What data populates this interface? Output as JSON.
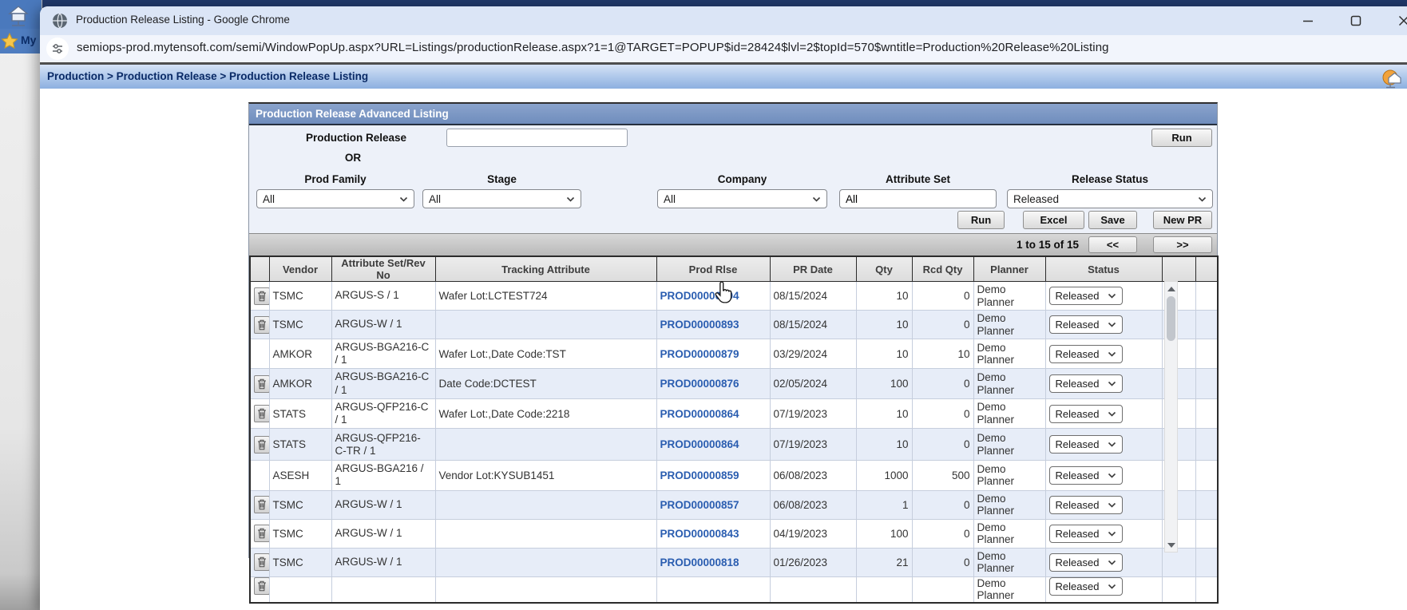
{
  "browser": {
    "window_title": "Production Release Listing - Google Chrome",
    "url": "semiops-prod.mytensoft.com/semi/WindowPopUp.aspx?URL=Listings/productionRelease.aspx?1=1@TARGET=POPUP$id=28424$lvl=2$topId=570$wntitle=Production%20Release%20Listing"
  },
  "parent_window": {
    "favorites_label": "My"
  },
  "breadcrumb": {
    "text": "Production > Production Release > Production Release Listing"
  },
  "panel": {
    "title": "Production Release Advanced Listing",
    "form": {
      "production_release": {
        "label": "Production Release",
        "value": ""
      },
      "or_label": "OR",
      "top_run_label": "Run",
      "filters": [
        {
          "label": "Prod Family",
          "type": "select",
          "value": "All"
        },
        {
          "label": "Stage",
          "type": "select",
          "value": "All"
        },
        {
          "label": "Company",
          "type": "select",
          "value": "All"
        },
        {
          "label": "Attribute Set",
          "type": "input",
          "value": "All"
        },
        {
          "label": "Release Status",
          "type": "select",
          "value": "Released"
        }
      ],
      "action_buttons": [
        "Run",
        "Excel",
        "Save",
        "New PR"
      ]
    },
    "pagination": {
      "range_text": "1 to 15 of 15",
      "prev_label": "<<",
      "next_label": ">>"
    }
  },
  "table": {
    "headers": [
      "",
      "Vendor",
      "Attribute Set/Rev No",
      "Tracking Attribute",
      "Prod Rlse",
      "PR Date",
      "Qty",
      "Rcd Qty",
      "Planner",
      "Status",
      "",
      ""
    ],
    "rows": [
      {
        "can_delete": true,
        "vendor": "TSMC",
        "attr_set": "ARGUS-S / 1",
        "tracking": "Wafer Lot:LCTEST724",
        "prod_rlse": "PROD00000894",
        "pr_date": "08/15/2024",
        "qty": "10",
        "rcd_qty": "0",
        "planner": "Demo Planner",
        "status": "Released"
      },
      {
        "can_delete": true,
        "vendor": "TSMC",
        "attr_set": "ARGUS-W / 1",
        "tracking": "",
        "prod_rlse": "PROD00000893",
        "pr_date": "08/15/2024",
        "qty": "10",
        "rcd_qty": "0",
        "planner": "Demo Planner",
        "status": "Released"
      },
      {
        "can_delete": false,
        "vendor": "AMKOR",
        "attr_set": "ARGUS-BGA216-C / 1",
        "tracking": "Wafer Lot:,Date Code:TST",
        "prod_rlse": "PROD00000879",
        "pr_date": "03/29/2024",
        "qty": "10",
        "rcd_qty": "10",
        "planner": "Demo Planner",
        "status": "Released"
      },
      {
        "can_delete": true,
        "vendor": "AMKOR",
        "attr_set": "ARGUS-BGA216-C / 1",
        "tracking": "Date Code:DCTEST",
        "prod_rlse": "PROD00000876",
        "pr_date": "02/05/2024",
        "qty": "100",
        "rcd_qty": "0",
        "planner": "Demo Planner",
        "status": "Released"
      },
      {
        "can_delete": true,
        "vendor": "STATS",
        "attr_set": "ARGUS-QFP216-C / 1",
        "tracking": "Wafer Lot:,Date Code:2218",
        "prod_rlse": "PROD00000864",
        "pr_date": "07/19/2023",
        "qty": "10",
        "rcd_qty": "0",
        "planner": "Demo Planner",
        "status": "Released"
      },
      {
        "can_delete": true,
        "vendor": "STATS",
        "attr_set": "ARGUS-QFP216-C-TR / 1",
        "tracking": "",
        "prod_rlse": "PROD00000864",
        "pr_date": "07/19/2023",
        "qty": "10",
        "rcd_qty": "0",
        "planner": "Demo Planner",
        "status": "Released",
        "tall": true
      },
      {
        "can_delete": false,
        "vendor": "ASESH",
        "attr_set": "ARGUS-BGA216 / 1",
        "tracking": "Vendor Lot:KYSUB1451",
        "prod_rlse": "PROD00000859",
        "pr_date": "06/08/2023",
        "qty": "1000",
        "rcd_qty": "500",
        "planner": "Demo Planner",
        "status": "Released"
      },
      {
        "can_delete": true,
        "vendor": "TSMC",
        "attr_set": "ARGUS-W / 1",
        "tracking": "",
        "prod_rlse": "PROD00000857",
        "pr_date": "06/08/2023",
        "qty": "1",
        "rcd_qty": "0",
        "planner": "Demo Planner",
        "status": "Released"
      },
      {
        "can_delete": true,
        "vendor": "TSMC",
        "attr_set": "ARGUS-W / 1",
        "tracking": "",
        "prod_rlse": "PROD00000843",
        "pr_date": "04/19/2023",
        "qty": "100",
        "rcd_qty": "0",
        "planner": "Demo Planner",
        "status": "Released"
      },
      {
        "can_delete": true,
        "vendor": "TSMC",
        "attr_set": "ARGUS-W / 1",
        "tracking": "",
        "prod_rlse": "PROD00000818",
        "pr_date": "01/26/2023",
        "qty": "21",
        "rcd_qty": "0",
        "planner": "Demo Planner",
        "status": "Released"
      },
      {
        "can_delete": true,
        "vendor": "",
        "attr_set": "",
        "tracking": "",
        "prod_rlse": "",
        "pr_date": "",
        "qty": "",
        "rcd_qty": "",
        "planner": "Demo Planner",
        "status": "Released",
        "partial": true
      }
    ]
  },
  "colors": {
    "panel_header_blue": "#7793c1",
    "breadcrumb_text": "#0a2a66",
    "link_blue": "#2a5db0",
    "row_stripe": "#e7edf8",
    "titlebar_blue": "#dbe5f6"
  }
}
